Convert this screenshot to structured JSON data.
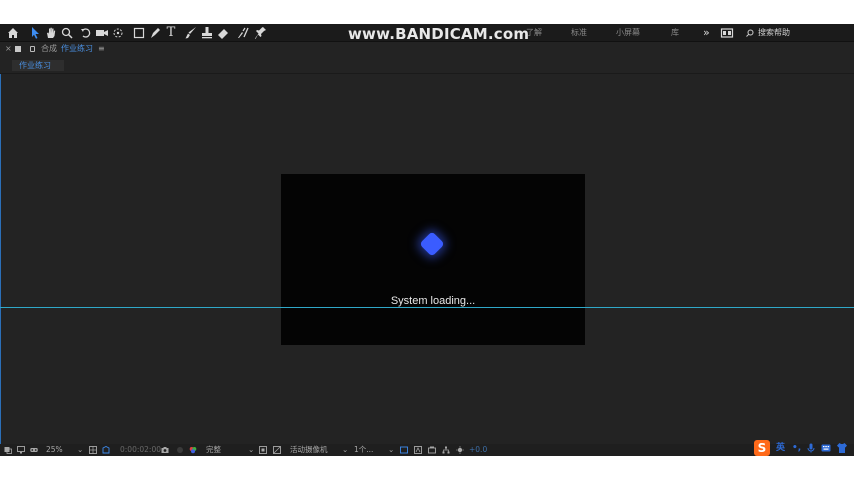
{
  "toolbar": {
    "icons": [
      "home-icon",
      "selection-arrow-icon",
      "hand-icon",
      "zoom-icon",
      "rotate-icon",
      "camera-icon",
      "pan-behind-icon",
      "rectangle-icon",
      "pen-icon",
      "type-icon",
      "brush-icon",
      "clone-stamp-icon",
      "eraser-icon",
      "roto-brush-icon",
      "puppet-pin-icon"
    ],
    "type_glyph": "T",
    "workspaces": [
      "了解",
      "标准",
      "小屏幕",
      "库"
    ],
    "overflow": "»",
    "search_label": "搜索帮助",
    "watermark": "www.BANDICAM.com"
  },
  "panel": {
    "close": "×",
    "label": "合成",
    "comp_name": "作业练习",
    "menu": "≡",
    "tab": "作业练习"
  },
  "viewer": {
    "loading_text": "System  loading...",
    "accent_color": "#3a5cff",
    "guide_color": "#2fa8c8"
  },
  "bottombar": {
    "zoom": "25%",
    "timecode": "0:00:02:00",
    "resolution": "完整",
    "camera": "活动摄像机",
    "views": "1个...",
    "exposure": "+0.0"
  },
  "ime": {
    "logo": "S",
    "lang": "英",
    "punct": "•,"
  }
}
